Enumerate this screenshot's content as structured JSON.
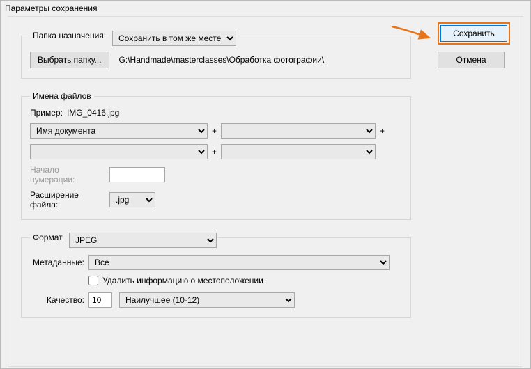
{
  "window": {
    "title": "Параметры сохранения"
  },
  "buttons": {
    "save": "Сохранить",
    "cancel": "Отмена",
    "choose_folder": "Выбрать папку..."
  },
  "dest": {
    "legend": "Папка назначения:",
    "selected": "Сохранить в том же месте",
    "path": "G:\\Handmade\\masterclasses\\Обработка фотографии\\"
  },
  "filenames": {
    "legend": "Имена файлов",
    "example_label": "Пример:",
    "example_value": "IMG_0416.jpg",
    "token1": "Имя документа",
    "token2": "",
    "token3": "",
    "token4": "",
    "plus": "+",
    "start_label": "Начало нумерации:",
    "start_value": "",
    "ext_label": "Расширение файла:",
    "ext_value": ".jpg"
  },
  "format": {
    "legend": "Формат:",
    "selected": "JPEG",
    "meta_label": "Метаданные:",
    "meta_selected": "Все",
    "remove_loc_label": "Удалить информацию о местоположении",
    "quality_label": "Качество:",
    "quality_value": "10",
    "quality_preset": "Наилучшее  (10-12)"
  }
}
